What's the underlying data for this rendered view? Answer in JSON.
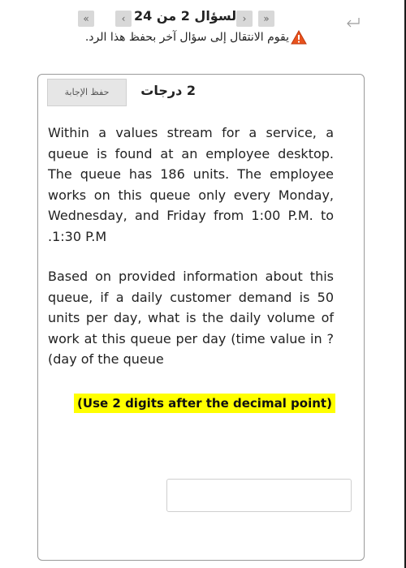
{
  "navigation": {
    "question_text": "السؤال 2 من 24",
    "first_glyph": "«",
    "prev_glyph": "‹",
    "next_glyph": "›",
    "last_glyph": "»"
  },
  "warning": {
    "text": "يقوم الانتقال إلى سؤال آخر بحفظ هذا الرد.",
    "icon": "warning-triangle-icon",
    "icon_color": "#e8521d"
  },
  "question": {
    "points": "2 درجات",
    "save_label": "حفظ الإجابة",
    "paragraph1": "Within a values stream for a service, a queue is found at an employee desktop. The queue has 186 units. The employee works on this queue only every Monday, Wednesday, and Friday from 1:00 P.M. to .1:30 P.M",
    "paragraph2": "Based on provided information about this queue, if a daily customer demand is 50 units per day, what is the daily volume of work at this queue per day (time value in ?(day of the queue",
    "instruction": "(Use 2 digits after the decimal point)",
    "answer_value": "",
    "highlight_color": "#ffff00"
  }
}
